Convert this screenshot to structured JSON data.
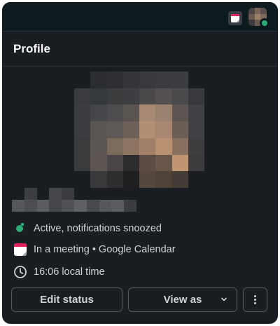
{
  "window": {
    "title": "Profile"
  },
  "topbar": {
    "calendar_icon": "calendar-icon",
    "avatar_icon": "user-avatar-icon"
  },
  "profile": {
    "status_text": "Active, notifications snoozed",
    "meeting_text": "In a meeting • Google Calendar",
    "local_time_text": "16:06 local time"
  },
  "actions": {
    "edit_status_label": "Edit status",
    "view_as_label": "View as",
    "more_icon": "kebab-icon"
  },
  "colors": {
    "background": "#1a1d21",
    "topbar": "#0d1b1e",
    "presence_active": "#2bac76",
    "calendar_red": "#e01e5a",
    "text": "#d1d2d3",
    "border": "#565856"
  }
}
